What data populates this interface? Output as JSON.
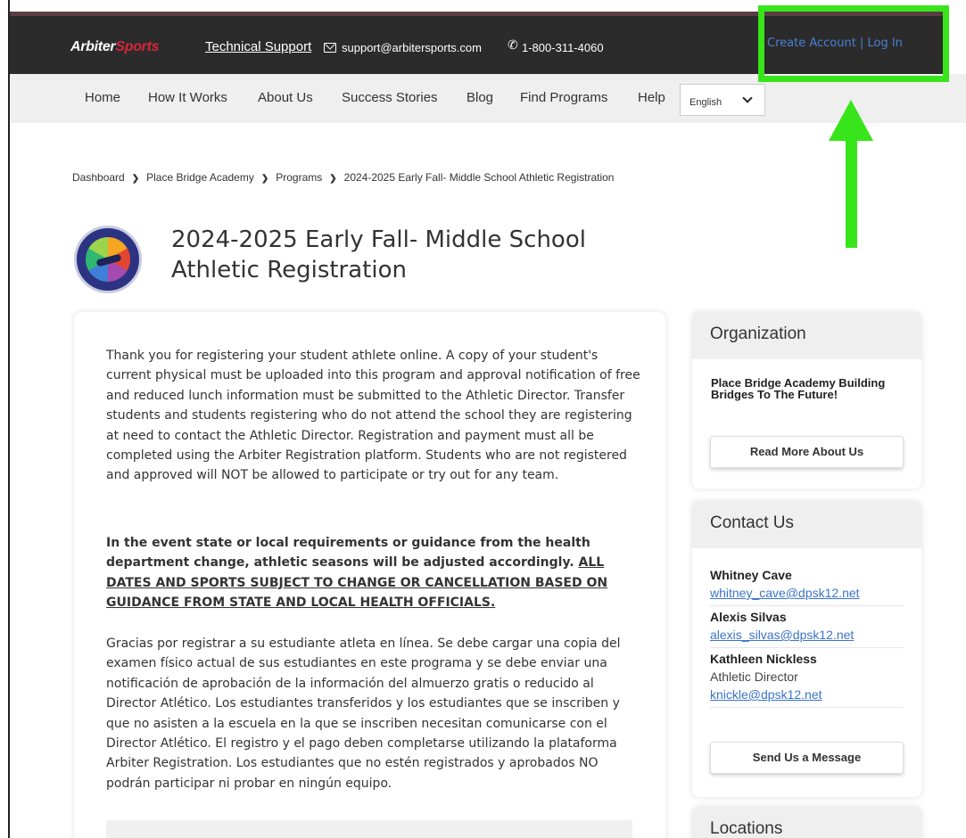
{
  "header": {
    "logo_primary": "Arbiter",
    "logo_secondary": "Sports",
    "tech_support": "Technical Support",
    "email": "support@arbitersports.com",
    "phone": "1-800-311-4060",
    "create_account": "Create Account",
    "separator": "|",
    "log_in": "Log In"
  },
  "nav": {
    "items": [
      {
        "label": "Home"
      },
      {
        "label": "How It Works"
      },
      {
        "label": "About Us"
      },
      {
        "label": "Success Stories"
      },
      {
        "label": "Blog"
      },
      {
        "label": "Find Programs"
      },
      {
        "label": "Help"
      }
    ],
    "language": "English"
  },
  "breadcrumb": [
    "Dashboard",
    "Place Bridge Academy",
    "Programs",
    "2024-2025 Early Fall- Middle School Athletic Registration"
  ],
  "page_title": "2024-2025 Early Fall- Middle School Athletic Registration",
  "main": {
    "p1": "Thank you for registering your student athlete online. A copy of your student's current physical must be uploaded into this program and approval notification of free and reduced lunch information must be submitted to the Athletic Director. Transfer students and students registering who do not attend the school they are registering at need to contact the Athletic Director. Registration and payment must all be completed using the Arbiter Registration platform. Students who are not registered and approved will NOT be allowed to participate or try out for any team.",
    "p2_bold": "In the event state or local requirements or guidance from the health department change, athletic seasons will be adjusted accordingly. ",
    "p2_underline": "ALL DATES AND SPORTS SUBJECT TO CHANGE OR CANCELLATION BASED ON GUIDANCE FROM STATE AND LOCAL HEALTH OFFICIALS.",
    "p3": "Gracias por registrar a su estudiante atleta en línea. Se debe cargar una copia del examen físico actual de sus estudiantes en este programa y se debe enviar una notificación de aprobación de la información del almuerzo gratis o reducido al Director Atlético. Los estudiantes transferidos y los estudiantes que se inscriben y que no asisten a la escuela en la que se inscriben necesitan comunicarse con el Director Atlético. El registro y el pago deben completarse utilizando la plataforma Arbiter Registration. Los estudiantes que no estén registrados y aprobados NO podrán participar ni probar en ningún equipo."
  },
  "sidebar": {
    "organization": {
      "heading": "Organization",
      "name": "Place Bridge Academy Building Bridges To The Future!",
      "button": "Read More About Us"
    },
    "contact": {
      "heading": "Contact Us",
      "people": [
        {
          "name": "Whitney Cave",
          "email": "whitney_cave@dpsk12.net"
        },
        {
          "name": "Alexis Silvas",
          "email": "alexis_silvas@dpsk12.net"
        },
        {
          "name": "Kathleen Nickless",
          "role": "Athletic Director",
          "email": "knickle@dpsk12.net"
        }
      ],
      "button": "Send Us a Message"
    },
    "locations": {
      "heading": "Locations"
    }
  },
  "colors": {
    "topbar": "#2b2b2b",
    "accent_red": "#d6263a",
    "link_blue": "#3a74c9",
    "annotation_green": "#38e51a"
  }
}
